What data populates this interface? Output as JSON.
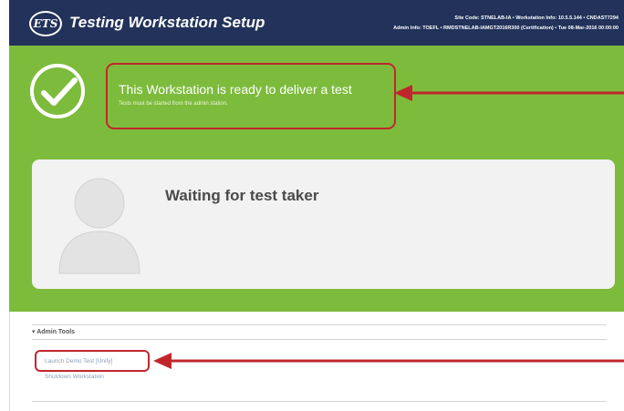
{
  "header": {
    "logo_text": "ETS",
    "title": "Testing Workstation Setup",
    "info_line1": "Site Code: STNELAB-IA  •  Workstation Info: 10.5.5.144  •  CNDAST7294",
    "info_line2": "Admin Info: TOEFL  •  RMDSTNELAB-IAMGT2016R300 (Certification)  •  Tue 08-Mar-2016 00:00:00"
  },
  "status": {
    "title": "This Workstation is ready to deliver a test",
    "subtitle": "Tests must be started from the admin station."
  },
  "card": {
    "waiting_text": "Waiting for test taker"
  },
  "admin": {
    "header": "▾ Admin Tools",
    "launch_label": "Launch Demo Test [Unify]",
    "shutdown_label": "Shutdown Workstation"
  },
  "colors": {
    "header_bg": "#22325a",
    "green_bg": "#7dbb3c",
    "highlight_red": "#c0272d"
  },
  "icons": [
    "checkmark-icon",
    "avatar-placeholder-icon",
    "red-arrow-icon"
  ]
}
